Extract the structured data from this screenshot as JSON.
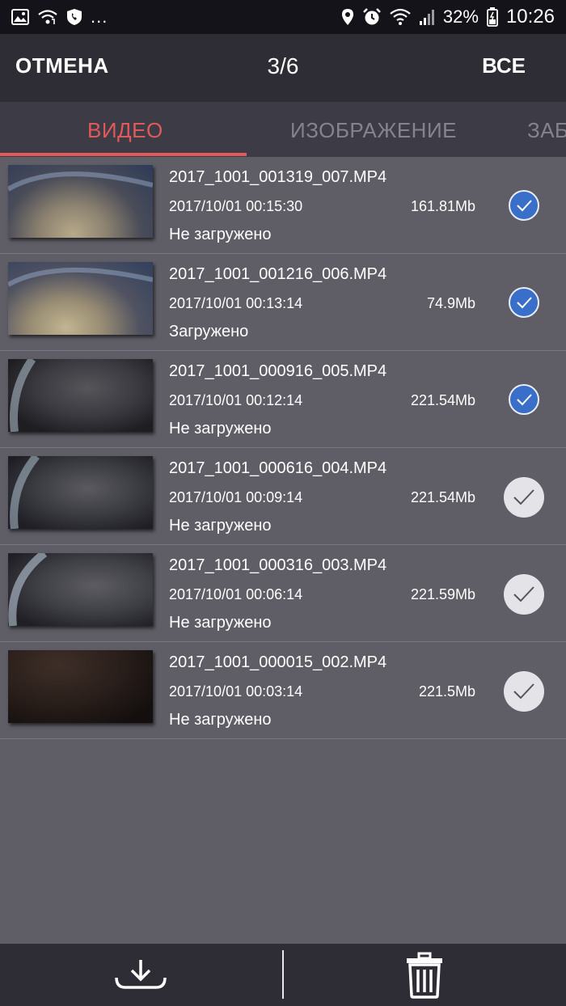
{
  "status_bar": {
    "battery_text": "32%",
    "time": "10:26",
    "more_indicator": "...",
    "left_icons": [
      "image-icon",
      "wifi-call-icon",
      "shield-phone-icon"
    ],
    "right_icons": [
      "location-icon",
      "alarm-icon",
      "wifi-icon",
      "signal-icon",
      "battery-icon"
    ]
  },
  "header": {
    "cancel_label": "ОТМЕНА",
    "counter": "3/6",
    "all_label": "ВСЕ"
  },
  "tabs": [
    {
      "label": "ВИДЕО",
      "active": true
    },
    {
      "label": "ИЗОБРАЖЕНИЕ",
      "active": false
    },
    {
      "label": "ЗАБ",
      "active": false
    }
  ],
  "videos": [
    {
      "name": "2017_1001_001319_007.MP4",
      "datetime": "2017/10/01 00:15:30",
      "size": "161.81Mb",
      "status": "Не загружено",
      "selected": true
    },
    {
      "name": "2017_1001_001216_006.MP4",
      "datetime": "2017/10/01 00:13:14",
      "size": "74.9Mb",
      "status": "Загружено",
      "selected": true
    },
    {
      "name": "2017_1001_000916_005.MP4",
      "datetime": "2017/10/01 00:12:14",
      "size": "221.54Mb",
      "status": "Не загружено",
      "selected": true
    },
    {
      "name": "2017_1001_000616_004.MP4",
      "datetime": "2017/10/01 00:09:14",
      "size": "221.54Mb",
      "status": "Не загружено",
      "selected": false
    },
    {
      "name": "2017_1001_000316_003.MP4",
      "datetime": "2017/10/01 00:06:14",
      "size": "221.59Mb",
      "status": "Не загружено",
      "selected": false
    },
    {
      "name": "2017_1001_000015_002.MP4",
      "datetime": "2017/10/01 00:03:14",
      "size": "221.5Mb",
      "status": "Не загружено",
      "selected": false
    }
  ],
  "bottom_bar": {
    "icons": [
      "download-icon",
      "trash-icon"
    ]
  },
  "colors": {
    "accent": "#e0595b",
    "selected_check": "#3a6fc9",
    "background": "#5f5d66",
    "header": "#2e2c35"
  }
}
